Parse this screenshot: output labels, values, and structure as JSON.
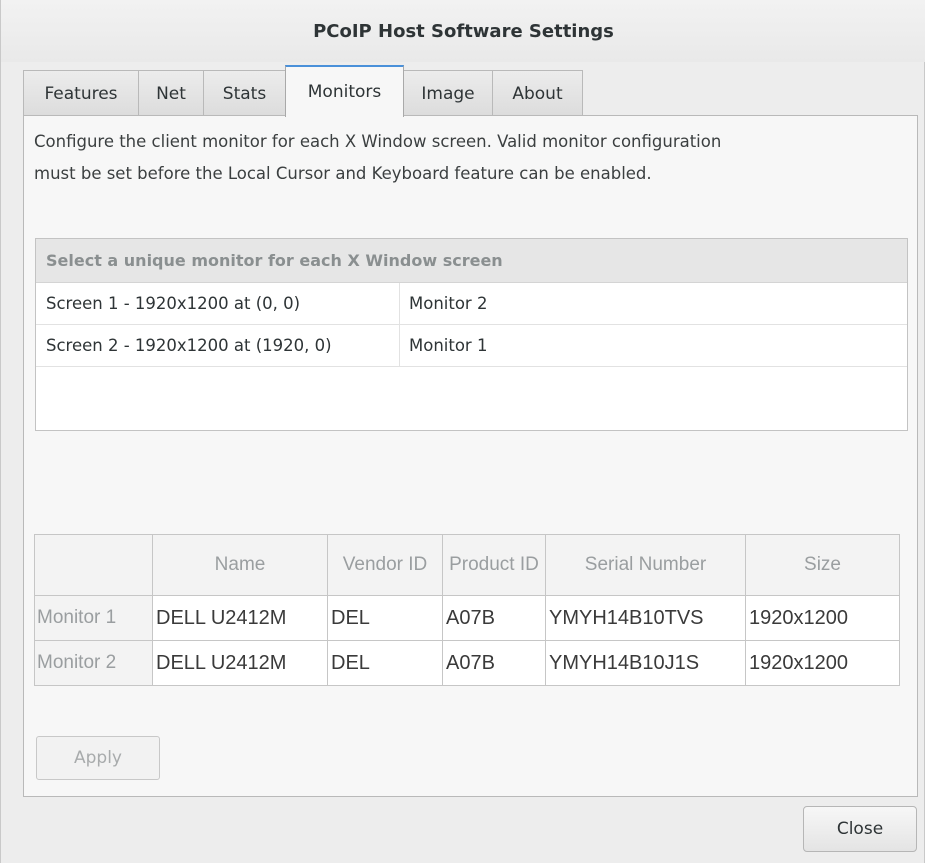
{
  "window": {
    "title": "PCoIP Host Software Settings"
  },
  "tabs": [
    {
      "label": "Features"
    },
    {
      "label": "Net"
    },
    {
      "label": "Stats"
    },
    {
      "label": "Monitors"
    },
    {
      "label": "Image"
    },
    {
      "label": "About"
    }
  ],
  "active_tab": "Monitors",
  "description": "Configure the client monitor for each X Window screen. Valid monitor configuration must be set before the Local Cursor and Keyboard feature can be enabled.",
  "screens": {
    "header": "Select a unique monitor for each X Window screen",
    "rows": [
      {
        "screen": "Screen 1 - 1920x1200 at (0, 0)",
        "monitor": "Monitor 2"
      },
      {
        "screen": "Screen 2 - 1920x1200 at (1920, 0)",
        "monitor": "Monitor 1"
      }
    ]
  },
  "monitors_table": {
    "columns": [
      "",
      "Name",
      "Vendor ID",
      "Product ID",
      "Serial Number",
      "Size"
    ],
    "rows": [
      {
        "label": "Monitor 1",
        "name": "DELL U2412M",
        "vendor": "DEL",
        "product": "A07B",
        "serial": "YMYH14B10TVS",
        "size": "1920x1200"
      },
      {
        "label": "Monitor 2",
        "name": "DELL U2412M",
        "vendor": "DEL",
        "product": "A07B",
        "serial": "YMYH14B10J1S",
        "size": "1920x1200"
      }
    ]
  },
  "buttons": {
    "apply": "Apply",
    "close": "Close"
  }
}
